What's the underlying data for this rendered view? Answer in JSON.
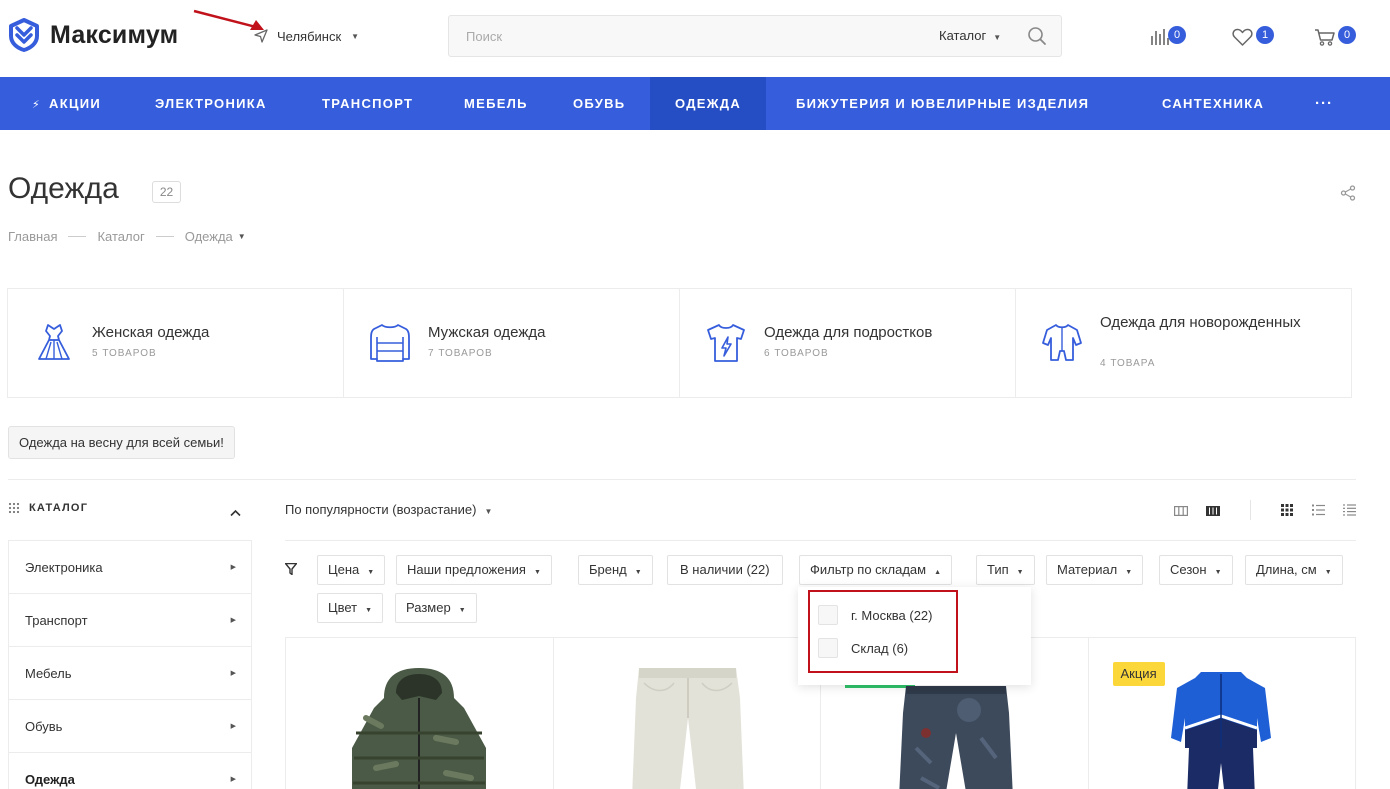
{
  "header": {
    "brand": "Максимум",
    "city": "Челябинск",
    "search_placeholder": "Поиск",
    "search_scope": "Каталог",
    "compare_count": "0",
    "favorites_count": "1",
    "cart_count": "0"
  },
  "nav": {
    "items": [
      "Акции",
      "Электроника",
      "Транспорт",
      "Мебель",
      "Обувь",
      "Одежда",
      "Бижутерия и ювелирные изделия",
      "Сантехника",
      "···"
    ],
    "active": "Одежда"
  },
  "page": {
    "title": "Одежда",
    "count": "22",
    "breadcrumbs": [
      "Главная",
      "Каталог",
      "Одежда"
    ]
  },
  "categories": [
    {
      "name": "Женская одежда",
      "count": "5 товаров",
      "icon": "dress-icon"
    },
    {
      "name": "Мужская одежда",
      "count": "7 товаров",
      "icon": "sweater-icon"
    },
    {
      "name": "Одежда для подростков",
      "count": "6 товаров",
      "icon": "tshirt-icon"
    },
    {
      "name": "Одежда для новорожденных",
      "count": "4 товара",
      "icon": "bodysuit-icon"
    }
  ],
  "promo_tag": "Одежда на весну для всей семьи!",
  "sidebar": {
    "title": "Каталог",
    "items": [
      "Электроника",
      "Транспорт",
      "Мебель",
      "Обувь",
      "Одежда"
    ],
    "active": "Одежда"
  },
  "sort": {
    "label": "По популярности (возрастание)"
  },
  "filters": {
    "chips": [
      "Цена",
      "Наши предложения",
      "Бренд",
      "В наличии (22)",
      "Фильтр по складам",
      "Тип",
      "Материал",
      "Сезон",
      "Длина, см",
      "Цвет",
      "Размер"
    ],
    "open": "Фильтр по складам",
    "dropdown_options": [
      "г. Москва (22)",
      "Склад (6)"
    ]
  },
  "products": {
    "badges": [
      "Акция"
    ]
  },
  "colors": {
    "accent": "#365edc",
    "nav_active": "#254ec5",
    "sale": "#fcd73a",
    "annotation": "#c1121c"
  }
}
